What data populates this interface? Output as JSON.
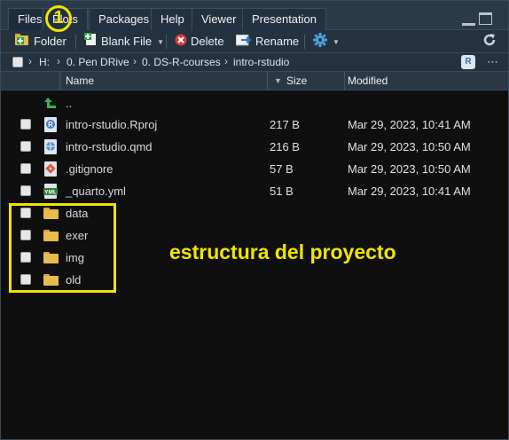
{
  "tabs": [
    {
      "label": "Files"
    },
    {
      "label": "Plots"
    },
    {
      "label": "Packages"
    },
    {
      "label": "Help"
    },
    {
      "label": "Viewer"
    },
    {
      "label": "Presentation"
    }
  ],
  "toolbar": {
    "new_folder_label": "Folder",
    "blank_file_label": "Blank File",
    "delete_label": "Delete",
    "rename_label": "Rename"
  },
  "breadcrumb": {
    "items": [
      "H:",
      "0. Pen DRive",
      "0. DS-R-courses",
      "intro-rstudio"
    ]
  },
  "table": {
    "headers": {
      "name": "Name",
      "size": "Size",
      "modified": "Modified"
    },
    "parent_label": "..",
    "rows": [
      {
        "name": "intro-rstudio.Rproj",
        "size": "217 B",
        "modified": "Mar 29, 2023, 10:41 AM",
        "icon": "rproj-icon"
      },
      {
        "name": "intro-rstudio.qmd",
        "size": "216 B",
        "modified": "Mar 29, 2023, 10:50 AM",
        "icon": "quarto-icon"
      },
      {
        "name": ".gitignore",
        "size": "57 B",
        "modified": "Mar 29, 2023, 10:50 AM",
        "icon": "git-icon"
      },
      {
        "name": "_quarto.yml",
        "size": "51 B",
        "modified": "Mar 29, 2023, 10:41 AM",
        "icon": "yml-icon"
      },
      {
        "name": "data",
        "size": "",
        "modified": "",
        "icon": "folder-icon"
      },
      {
        "name": "exer",
        "size": "",
        "modified": "",
        "icon": "folder-icon"
      },
      {
        "name": "img",
        "size": "",
        "modified": "",
        "icon": "folder-icon"
      },
      {
        "name": "old",
        "size": "",
        "modified": "",
        "icon": "folder-icon"
      }
    ]
  },
  "annotation": {
    "text": "estructura del proyecto",
    "marker_number": "1",
    "color": "#f2e400"
  }
}
